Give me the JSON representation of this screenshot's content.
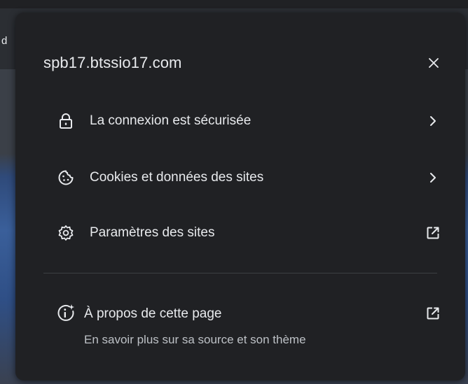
{
  "background": {
    "partial_text": "d"
  },
  "popup": {
    "site_title": "spb17.btssio17.com",
    "close_icon": "close-icon",
    "items": [
      {
        "label": "La connexion est sécurisée",
        "icon": "lock-icon",
        "trailing": "chevron-right-icon"
      },
      {
        "label": "Cookies et données des sites",
        "icon": "cookie-icon",
        "trailing": "chevron-right-icon"
      },
      {
        "label": "Paramètres des sites",
        "icon": "settings-gear-icon",
        "trailing": "open-external-icon"
      }
    ],
    "about": {
      "title": "À propos de cette page",
      "subtitle": "En savoir plus sur sa source et son thème",
      "icon": "info-sparkle-icon",
      "trailing": "open-external-icon"
    }
  },
  "colors": {
    "popup_bg": "#202124",
    "text_primary": "#e8eaed",
    "text_secondary": "#bdc1c6",
    "divider": "#3c4043"
  }
}
